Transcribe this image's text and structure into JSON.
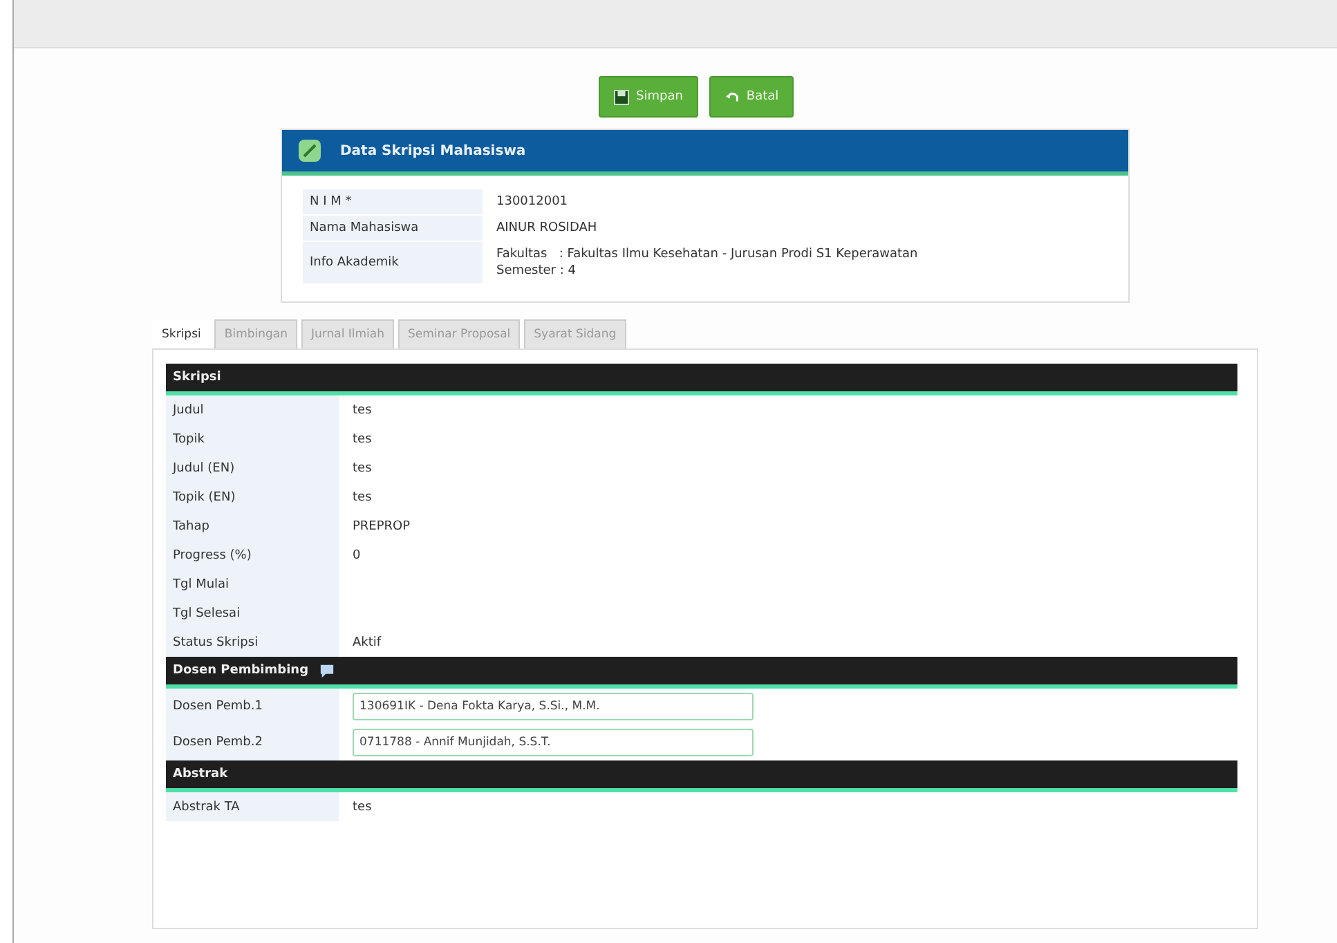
{
  "toolbar": {
    "buttons": [
      {
        "label": "Simpan",
        "kind": "save"
      },
      {
        "label": "Batal",
        "kind": "undo"
      }
    ]
  },
  "student_card": {
    "title": "Data Skripsi Mahasiswa",
    "rows": [
      {
        "label": "N I M *",
        "lines": [
          "130012001"
        ]
      },
      {
        "label": "Nama Mahasiswa",
        "lines": [
          "AINUR ROSIDAH"
        ]
      },
      {
        "label": "Info Akademik",
        "lines": [
          "Fakultas   : Fakultas Ilmu Kesehatan - Jurusan Prodi S1 Keperawatan",
          "Semester : 4"
        ]
      }
    ]
  },
  "tabs": [
    {
      "label": "Skripsi",
      "selected": true
    },
    {
      "label": "Bimbingan",
      "selected": false
    },
    {
      "label": "Jurnal Ilmiah",
      "selected": false
    },
    {
      "label": "Seminar Proposal",
      "selected": false
    },
    {
      "label": "Syarat Sidang",
      "selected": false
    }
  ],
  "sections": [
    {
      "title": "Skripsi",
      "has_icon": false,
      "rows": [
        {
          "label": "Judul",
          "value": "tes",
          "kind": "text"
        },
        {
          "label": "Topik",
          "value": "tes",
          "kind": "text"
        },
        {
          "label": "Judul (EN)",
          "value": "tes",
          "kind": "text"
        },
        {
          "label": "Topik (EN)",
          "value": "tes",
          "kind": "text"
        },
        {
          "label": "Tahap",
          "value": "PREPROP",
          "kind": "text"
        },
        {
          "label": "Progress (%)",
          "value": "0",
          "kind": "text"
        },
        {
          "label": "Tgl Mulai",
          "kind": "text"
        },
        {
          "label": "Tgl Selesai",
          "kind": "text"
        },
        {
          "label": "Status Skripsi",
          "value": "Aktif",
          "kind": "text"
        }
      ]
    },
    {
      "title": "Dosen Pembimbing",
      "has_icon": true,
      "rows": [
        {
          "label": "Dosen Pemb.1",
          "value": "130691IK - Dena Fokta Karya, S.Si., M.M.",
          "kind": "field"
        },
        {
          "label": "Dosen Pemb.2",
          "value": "0711788 - Annif Munjidah, S.S.T.",
          "kind": "field"
        }
      ]
    },
    {
      "title": "Abstrak",
      "has_icon": false,
      "rows": [
        {
          "label": "Abstrak TA",
          "value": "tes",
          "kind": "text"
        }
      ]
    }
  ]
}
